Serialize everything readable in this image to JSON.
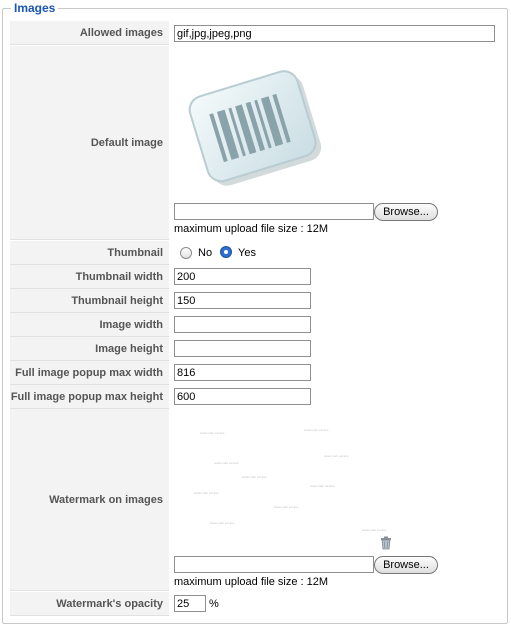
{
  "section": {
    "legend": "Images"
  },
  "fields": {
    "allowed_images": {
      "label": "Allowed images",
      "value": "gif,jpg,jpeg,png"
    },
    "default_image": {
      "label": "Default image",
      "browse_label": "Browse...",
      "file_value": "",
      "upload_note": "maximum upload file size : 12M"
    },
    "thumbnail": {
      "label": "Thumbnail",
      "options": [
        "No",
        "Yes"
      ],
      "selected": "Yes"
    },
    "thumbnail_width": {
      "label": "Thumbnail width",
      "value": "200"
    },
    "thumbnail_height": {
      "label": "Thumbnail height",
      "value": "150"
    },
    "image_width": {
      "label": "Image width",
      "value": ""
    },
    "image_height": {
      "label": "Image height",
      "value": ""
    },
    "popup_max_width": {
      "label": "Full image popup max width",
      "value": "816"
    },
    "popup_max_height": {
      "label": "Full image popup max height",
      "value": "600"
    },
    "watermark": {
      "label": "Watermark on images",
      "browse_label": "Browse...",
      "file_value": "",
      "upload_note": "maximum upload file size : 12M"
    },
    "watermark_opacity": {
      "label": "Watermark's opacity",
      "value": "25",
      "unit": "%"
    }
  },
  "icons": {
    "default_image": "barcode-image",
    "delete": "trash-icon"
  },
  "colors": {
    "legend": "#1b55b3",
    "label_bg": "#f3f3f3",
    "radio_selected": "#2f6fd0"
  }
}
